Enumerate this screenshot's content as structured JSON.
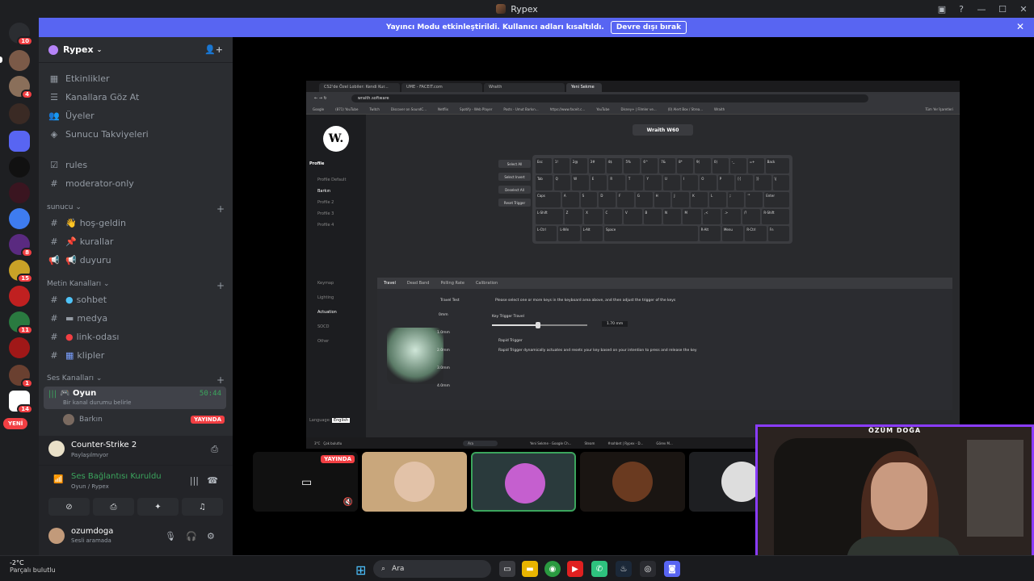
{
  "window": {
    "title": "Rypex",
    "controls": [
      "minimize",
      "maximize",
      "close"
    ]
  },
  "banner": {
    "text": "Yayıncı Modu etkinleştirildi. Kullanıcı adları kısaltıldı.",
    "button": "Devre dışı bırak"
  },
  "servers": {
    "badges": [
      "10",
      "4",
      "8",
      "15",
      "11",
      "1",
      "14"
    ],
    "new_label": "YENİ"
  },
  "guild": {
    "name": "Rypex",
    "menu": [
      "Etkinlikler",
      "Kanallara Göz At",
      "Üyeler",
      "Sunucu Takviyeleri"
    ],
    "channels_top": [
      "rules",
      "moderator-only"
    ],
    "categories": {
      "sunucu": "sunucu",
      "metin": "Metin Kanalları",
      "ses": "Ses Kanalları"
    },
    "sunucu_channels": [
      "hoş-geldin",
      "kurallar",
      "duyuru"
    ],
    "metin_channels": [
      "sohbet",
      "medya",
      "link-odası",
      "klipler"
    ],
    "voice_channel": {
      "name": "Oyun",
      "status": "Bir kanal durumu belirle",
      "timer": "50:44"
    },
    "voice_member": {
      "name": "Barkın",
      "badge": "YAYINDA"
    }
  },
  "activity": {
    "game": "Counter-Strike 2",
    "sub": "Paylaşılmıyor"
  },
  "rtc": {
    "status": "Ses Bağlantısı Kuruldu",
    "location": "Oyun / Rypex"
  },
  "user": {
    "name": "ozumdoga",
    "status": "Sesli aramada"
  },
  "shared_screen": {
    "tabs": [
      "CS2'de Özel Lobiler: Kendi Kur...",
      "UME - FACEIT.com",
      "Wraith",
      "Yeni Sekme"
    ],
    "url": "wraith.software",
    "bookmarks": [
      "Google",
      "(871) YouTube",
      "Twitch",
      "Discover on SoundC...",
      "Netflix",
      "Spotify - Web Player",
      "Posts - Umut Barkın...",
      "https://www.faceit.c...",
      "YouTube",
      "Disney+ | Filmler ve...",
      "(0) Alert Box / Strea...",
      "Wraith",
      "Tüm Yer İşaretleri"
    ],
    "product": "Wraith W60",
    "side_items": [
      "Profile",
      "Profile Default",
      "Barkın",
      "Profile 2",
      "Profile 3",
      "Profile 4",
      "Keymap",
      "Lighting",
      "Actuation",
      "SOCD",
      "Other"
    ],
    "language_label": "Language:",
    "language_value": "English",
    "kbd_buttons": [
      "Select All",
      "Select Invert",
      "Deselect All",
      "Reset Trigger"
    ],
    "key_rows": [
      [
        "Esc",
        "1!",
        "2@",
        "3#",
        "4$",
        "5%",
        "6^",
        "7&",
        "8*",
        "9(",
        "0)",
        "-_",
        "=+",
        "Back"
      ],
      [
        "Tab",
        "Q",
        "W",
        "E",
        "R",
        "T",
        "Y",
        "U",
        "I",
        "O",
        "P",
        "[{",
        "]}",
        "\\|"
      ],
      [
        "Caps",
        "A",
        "S",
        "D",
        "F",
        "G",
        "H",
        "J",
        "K",
        "L",
        ";:",
        "'\"",
        "Enter"
      ],
      [
        "L-Shift",
        "Z",
        "X",
        "C",
        "V",
        "B",
        "N",
        "M",
        ",<",
        ".>",
        "/?",
        "R-Shift"
      ],
      [
        "L-Ctrl",
        "L-Win",
        "L-Alt",
        "Space",
        "R-Alt",
        "Menu",
        "R-Ctrl",
        "Fn"
      ]
    ],
    "panel_tabs": [
      "Travel",
      "Dead Band",
      "Polling Rate",
      "Calibration"
    ],
    "travel_test": "Travel Test",
    "instruction": "Please select one or more keys in the keyboard area above, and then adjust the trigger of the keys",
    "key_trigger_label": "Key Trigger Travel",
    "key_trigger_value": "1.70 mm",
    "key_trigger_fraction": 0.48,
    "rapid_trigger": "Rapid Trigger",
    "rapid_desc": "Rapid Trigger dynamically actuates and resets your key based on your intention to press and release the key",
    "scale": [
      "0mm",
      "1.0mm",
      "2.0mm",
      "3.0mm",
      "4.0mm"
    ],
    "taskbar_weather": "3°C",
    "taskbar_weather_sub": "Çok bulutlu",
    "taskbar_search": "Ara",
    "taskbar_items": [
      "Yeni Sekme - Google Ch...",
      "Steam",
      "#sohbet | Rypex - D...",
      "Görev M..."
    ]
  },
  "thumbs": {
    "live_label": "YAYINDA"
  },
  "webcam": {
    "name": "ÖZÜM DOĞA"
  },
  "taskbar": {
    "temp": "-2°C",
    "weather": "Parçalı bulutlu",
    "search": "Ara"
  }
}
